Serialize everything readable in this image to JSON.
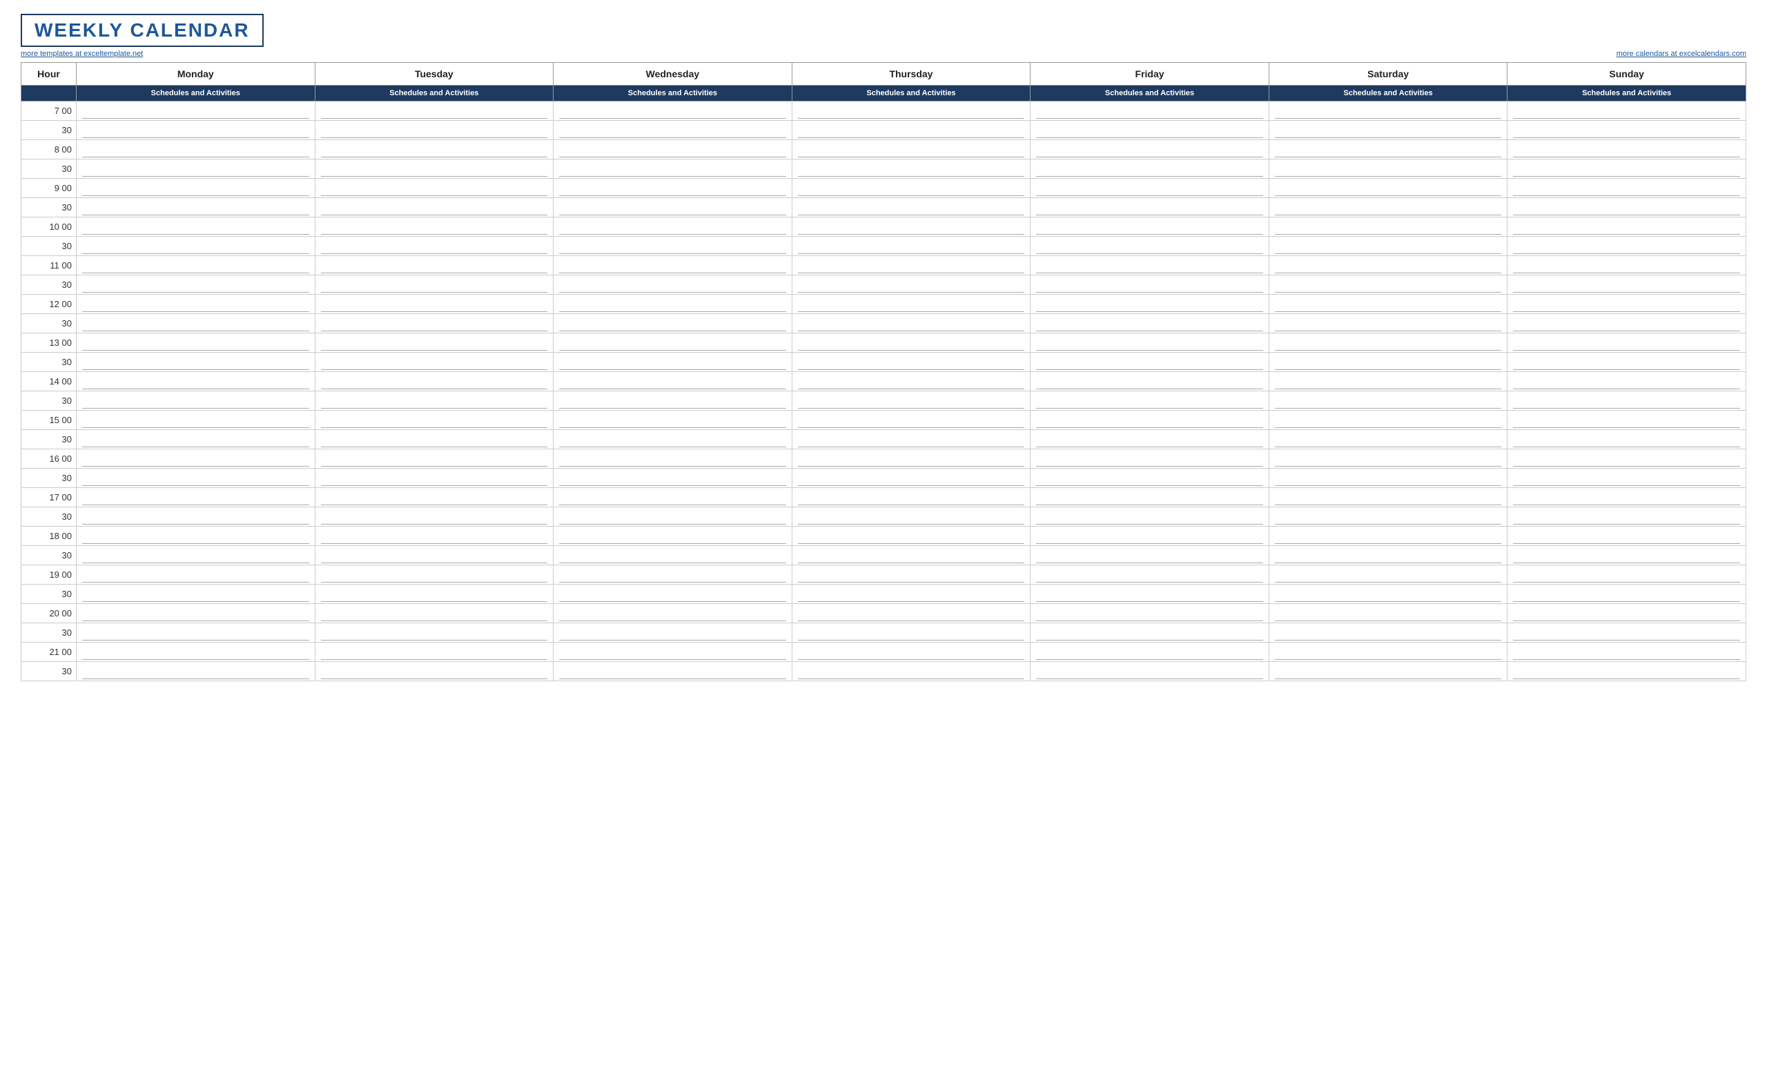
{
  "title": "WEEKLY CALENDAR",
  "link_left": "more templates at exceltemplate.net",
  "link_right": "more calendars at excelcalendars.com",
  "hour_header": "Hour",
  "sub_header_label": "Schedules and Activities",
  "days": [
    "Monday",
    "Tuesday",
    "Wednesday",
    "Thursday",
    "Friday",
    "Saturday",
    "Sunday"
  ],
  "hours": [
    {
      "label": "7  00",
      "half": "30"
    },
    {
      "label": "8  00",
      "half": "30"
    },
    {
      "label": "9  00",
      "half": "30"
    },
    {
      "label": "10  00",
      "half": "30"
    },
    {
      "label": "11  00",
      "half": "30"
    },
    {
      "label": "12  00",
      "half": "30"
    },
    {
      "label": "13  00",
      "half": "30"
    },
    {
      "label": "14  00",
      "half": "30"
    },
    {
      "label": "15  00",
      "half": "30"
    },
    {
      "label": "16  00",
      "half": "30"
    },
    {
      "label": "17  00",
      "half": "30"
    },
    {
      "label": "18  00",
      "half": "30"
    },
    {
      "label": "19  00",
      "half": "30"
    },
    {
      "label": "20  00",
      "half": "30"
    },
    {
      "label": "21  00",
      "half": "30"
    }
  ]
}
